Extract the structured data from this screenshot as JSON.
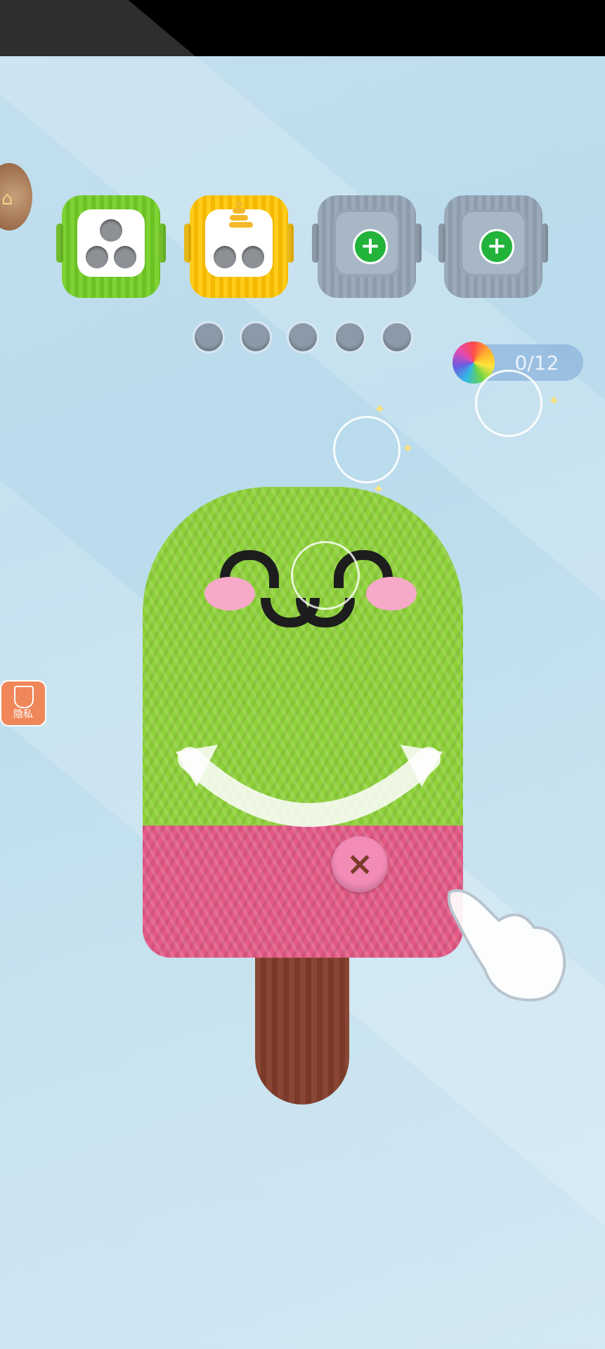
{
  "game": {
    "progress_label": "0/12",
    "progress_value": 0,
    "progress_total": 12,
    "privacy_label": "隐私",
    "slots": [
      {
        "state": "filled",
        "color": "green",
        "holes": 3
      },
      {
        "state": "filled",
        "color": "yellow",
        "holes": 3,
        "spool": true
      },
      {
        "state": "locked",
        "color": "grey",
        "action": "add"
      },
      {
        "state": "locked",
        "color": "grey",
        "action": "add"
      }
    ],
    "queue_dots": 5,
    "button_symbol": "×",
    "icons": [
      "treasure-chest-icon",
      "plus-icon",
      "yarn-ball-icon",
      "shield-icon",
      "hand-pointer-icon",
      "curved-arrow-icon"
    ]
  },
  "colors": {
    "popsicle_top": "#8ed23a",
    "popsicle_bottom": "#e45a86",
    "stick": "#7a3a2a",
    "slot_green": "#7fd233",
    "slot_yellow": "#ffcc1a",
    "slot_grey": "#9aaab9",
    "add_green": "#22b33a"
  }
}
